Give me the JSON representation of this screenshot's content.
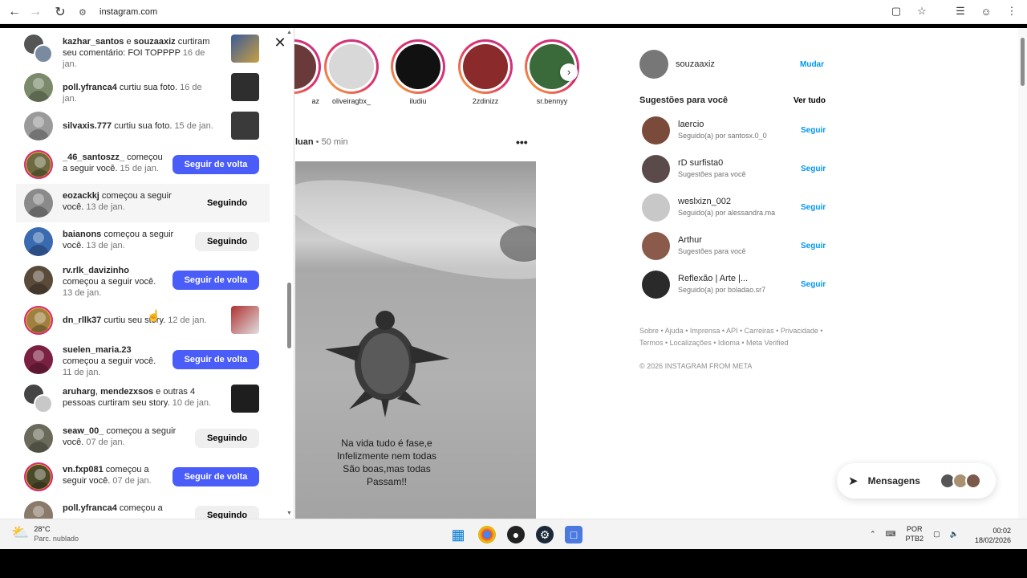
{
  "browser": {
    "url": "instagram.com"
  },
  "notifications": [
    {
      "user": "kazhar_santos",
      "text": " e ",
      "user2": "souzaaxiz",
      "rest": " curtiram seu comentário: FOI TOPPPP ",
      "time": "16 de jan.",
      "kind": "thumb"
    },
    {
      "user": "poll.yfranca4",
      "text": " curtiu sua foto. ",
      "time": "16 de jan.",
      "kind": "thumb"
    },
    {
      "user": "silvaxis.777",
      "text": " curtiu sua foto. ",
      "time": "15 de jan.",
      "kind": "thumb"
    },
    {
      "user": "_46_santoszz_",
      "text": " começou a seguir você. ",
      "time": "15 de jan.",
      "kind": "follow-back",
      "button": "Seguir de volta"
    },
    {
      "user": "eozackkj",
      "text": " começou a seguir você. ",
      "time": "13 de jan.",
      "kind": "following",
      "button": "Seguindo"
    },
    {
      "user": "baianons",
      "text": " começou a seguir você. ",
      "time": "13 de jan.",
      "kind": "following",
      "button": "Seguindo"
    },
    {
      "user": "rv.rlk_davizinho",
      "text": " começou a seguir você. ",
      "time": "13 de jan.",
      "kind": "follow-back",
      "button": "Seguir de volta"
    },
    {
      "user": "dn_rllk37",
      "text": " curtiu seu story. ",
      "time": "12 de jan.",
      "kind": "thumb"
    },
    {
      "user": "suelen_maria.23",
      "text": " começou a seguir você. ",
      "time": "11 de jan.",
      "kind": "follow-back",
      "button": "Seguir de volta"
    },
    {
      "user": "aruharg",
      "text": ", ",
      "user2": "mendezxsos",
      "rest": " e outras 4 pessoas curtiram seu story. ",
      "time": "10 de jan.",
      "kind": "thumb"
    },
    {
      "user": "seaw_00_",
      "text": " começou a seguir você. ",
      "time": "07 de jan.",
      "kind": "following",
      "button": "Seguindo"
    },
    {
      "user": "vn.fxp081",
      "text": " começou a seguir você. ",
      "time": "07 de jan.",
      "kind": "follow-back",
      "button": "Seguir de volta"
    },
    {
      "user": "poll.yfranca4",
      "text": " começou a",
      "time": "",
      "kind": "following",
      "button": "Seguindo"
    }
  ],
  "stories": [
    {
      "name": "az"
    },
    {
      "name": "oliveiragbx_"
    },
    {
      "name": "iludiu"
    },
    {
      "name": "2zdinizz"
    },
    {
      "name": "sr.bennyy"
    }
  ],
  "post": {
    "author": "luan",
    "sep": " • ",
    "time": "50 min",
    "caption_lines": [
      "Na vida tudo é fase,e",
      "Infelizmente nem todas",
      "São boas,mas todas",
      "Passam!!"
    ]
  },
  "sidebar": {
    "username": "souzaaxiz",
    "switch_label": "Mudar",
    "suggestions_title": "Sugestões para você",
    "see_all": "Ver tudo",
    "suggestions": [
      {
        "name": "laercio",
        "sub": "Seguido(a) por santosx.0_0",
        "follow": "Seguir"
      },
      {
        "name": "rD surfista0",
        "sub": "Sugestões para você",
        "follow": "Seguir"
      },
      {
        "name": "weslxizn_002",
        "sub": "Seguido(a) por alessandra.ma",
        "follow": "Seguir"
      },
      {
        "name": "Arthur",
        "sub": "Sugestões para você",
        "follow": "Seguir"
      },
      {
        "name": "Reflexão | Arte |...",
        "sub": "Seguido(a) por boladao.sr7",
        "follow": "Seguir"
      }
    ],
    "footer_line1": "Sobre • Ajuda • Imprensa • API • Carreiras • Privacidade •",
    "footer_line2": "Termos • Localizações • Idioma • Meta Verified",
    "copyright": "© 2026 INSTAGRAM FROM META"
  },
  "messages": {
    "label": "Mensagens"
  },
  "taskbar": {
    "temp": "28°C",
    "weather": "Parc. nublado",
    "lang1": "POR",
    "lang2": "PTB2",
    "time": "00:02",
    "date": "18/02/2026"
  }
}
